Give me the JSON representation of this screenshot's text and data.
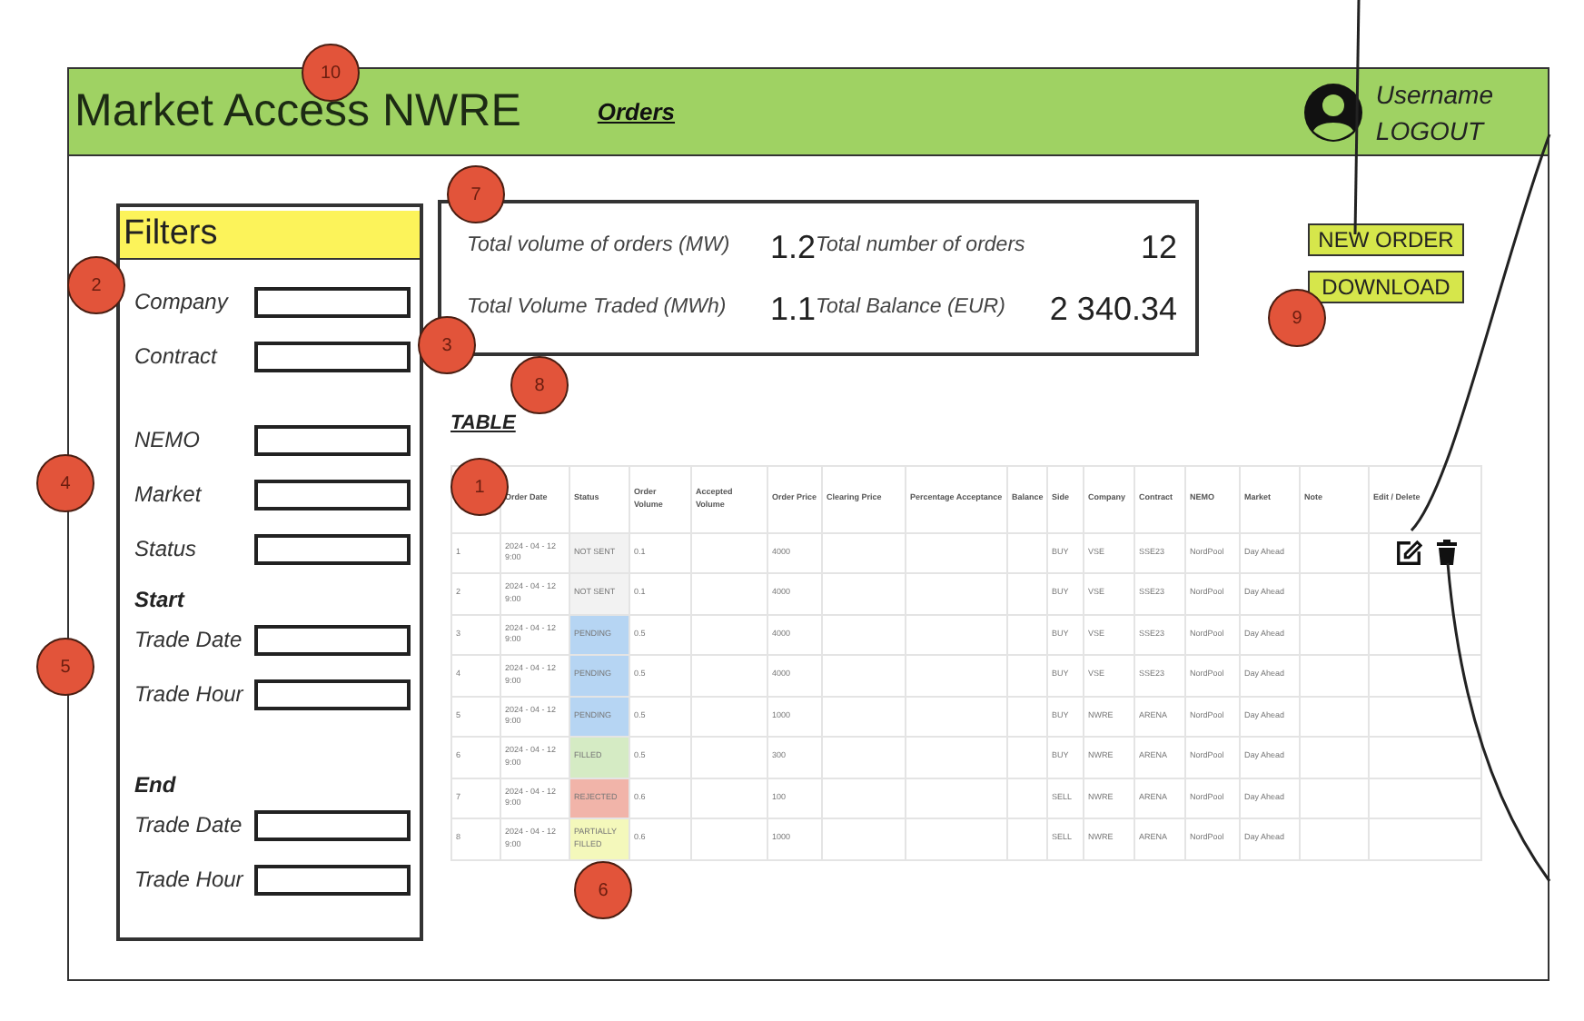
{
  "header": {
    "title": "Market Access NWRE",
    "nav_link": "Orders",
    "username": "Username",
    "logout": "LOGOUT"
  },
  "filters": {
    "title": "Filters",
    "sections": [
      {
        "fields": [
          "Company",
          "Contract"
        ]
      },
      {
        "fields": [
          "NEMO",
          "Market",
          "Status"
        ]
      },
      {
        "heading": "Start",
        "fields": [
          "Trade Date",
          "Trade Hour"
        ]
      },
      {
        "heading": "End",
        "fields": [
          "Trade Date",
          "Trade Hour"
        ]
      }
    ]
  },
  "summary": [
    {
      "label": "Total volume of orders (MW)",
      "value": "1.2"
    },
    {
      "label": "Total number of orders",
      "value": "12"
    },
    {
      "label": "Total Volume Traded (MWh)",
      "value": "1.1"
    },
    {
      "label": "Total Balance (EUR)",
      "value": "2 340.34"
    }
  ],
  "buttons": [
    "NEW ORDER",
    "DOWNLOAD"
  ],
  "table": {
    "title": "TABLE",
    "columns": [
      "Order Date",
      "Status",
      "Order Volume",
      "Accepted Volume",
      "Order Price",
      "Clearing Price",
      "Percentage Acceptance",
      "Balance",
      "Side",
      "Company",
      "Contract",
      "NEMO",
      "Market",
      "Note",
      "Edit / Delete"
    ],
    "rows": [
      {
        "number": "1",
        "order_date": "2024 - 04 - 12 9:00",
        "status": "NOT SENT",
        "color": "#f2f2f2",
        "order_volume": "0.1",
        "order_price": "4000",
        "side": "BUY",
        "company": "VSE",
        "contract": "SSE23",
        "nemo": "NordPool",
        "market": "Day Ahead",
        "editable": true
      },
      {
        "number": "2",
        "order_date": "2024 - 04 - 12 9:00",
        "status": "NOT SENT",
        "color": "#f2f2f2",
        "order_volume": "0.1",
        "order_price": "4000",
        "side": "BUY",
        "company": "VSE",
        "contract": "SSE23",
        "nemo": "NordPool",
        "market": "Day Ahead",
        "editable": false
      },
      {
        "number": "3",
        "order_date": "2024 - 04 - 12 9:00",
        "status": "PENDING",
        "color": "#b6d5f3",
        "order_volume": "0.5",
        "order_price": "4000",
        "side": "BUY",
        "company": "VSE",
        "contract": "SSE23",
        "nemo": "NordPool",
        "market": "Day Ahead",
        "editable": false
      },
      {
        "number": "4",
        "order_date": "2024 - 04 - 12 9:00",
        "status": "PENDING",
        "color": "#b6d5f3",
        "order_volume": "0.5",
        "order_price": "4000",
        "side": "BUY",
        "company": "VSE",
        "contract": "SSE23",
        "nemo": "NordPool",
        "market": "Day Ahead",
        "editable": false
      },
      {
        "number": "5",
        "order_date": "2024 - 04 - 12 9:00",
        "status": "PENDING",
        "color": "#b6d5f3",
        "order_volume": "0.5",
        "order_price": "1000",
        "side": "BUY",
        "company": "NWRE",
        "contract": "ARENA",
        "nemo": "NordPool",
        "market": "Day Ahead",
        "editable": false
      },
      {
        "number": "6",
        "order_date": "2024 - 04 - 12 9:00",
        "status": "FILLED",
        "color": "#d5ebc4",
        "order_volume": "0.5",
        "order_price": "300",
        "side": "BUY",
        "company": "NWRE",
        "contract": "ARENA",
        "nemo": "NordPool",
        "market": "Day Ahead",
        "editable": false
      },
      {
        "number": "7",
        "order_date": "2024 - 04 - 12 9:00",
        "status": "REJECTED",
        "color": "#f1b4a9",
        "order_volume": "0.6",
        "order_price": "100",
        "side": "SELL",
        "company": "NWRE",
        "contract": "ARENA",
        "nemo": "NordPool",
        "market": "Day Ahead",
        "editable": false
      },
      {
        "number": "8",
        "order_date": "2024 - 04 - 12 9:00",
        "status": "PARTIALLY FILLED",
        "color": "#f4f8bb",
        "order_volume": "0.6",
        "order_price": "1000",
        "side": "SELL",
        "company": "NWRE",
        "contract": "ARENA",
        "nemo": "NordPool",
        "market": "Day Ahead",
        "editable": false
      }
    ]
  },
  "annotations": [
    {
      "label": "10"
    },
    {
      "label": "2"
    },
    {
      "label": "3"
    },
    {
      "label": "4"
    },
    {
      "label": "5"
    },
    {
      "label": "7"
    },
    {
      "label": "8"
    },
    {
      "label": "9"
    },
    {
      "label": "1"
    },
    {
      "label": "6"
    }
  ]
}
